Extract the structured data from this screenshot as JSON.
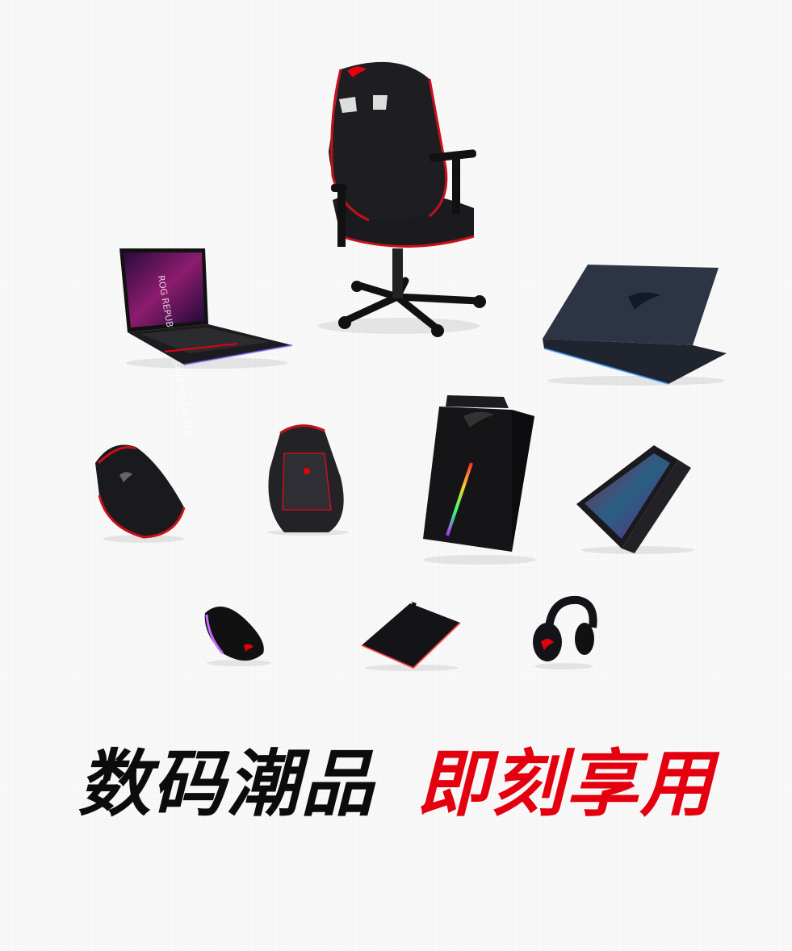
{
  "headline": {
    "part1": "数码潮品",
    "part2": "即刻享用"
  },
  "products": [
    {
      "id": "gaming-chair",
      "icon": "gaming-chair-icon"
    },
    {
      "id": "laptop-open",
      "icon": "laptop-open-icon",
      "screen_text": "ROG REPUBLIC OF GAMERS JOIN THE"
    },
    {
      "id": "laptop-closed",
      "icon": "laptop-closed-icon"
    },
    {
      "id": "backpack-shell",
      "icon": "backpack-icon"
    },
    {
      "id": "backpack-large",
      "icon": "backpack-icon"
    },
    {
      "id": "desktop-tower",
      "icon": "desktop-tower-icon"
    },
    {
      "id": "keyboard",
      "icon": "keyboard-icon"
    },
    {
      "id": "mouse",
      "icon": "mouse-icon"
    },
    {
      "id": "mousepad",
      "icon": "mousepad-icon"
    },
    {
      "id": "headset",
      "icon": "headset-icon"
    }
  ],
  "colors": {
    "brand_red": "#e5000f",
    "product_black": "#1a1a1e",
    "headline_black": "#0c0c0c",
    "background": "#fafafa"
  }
}
